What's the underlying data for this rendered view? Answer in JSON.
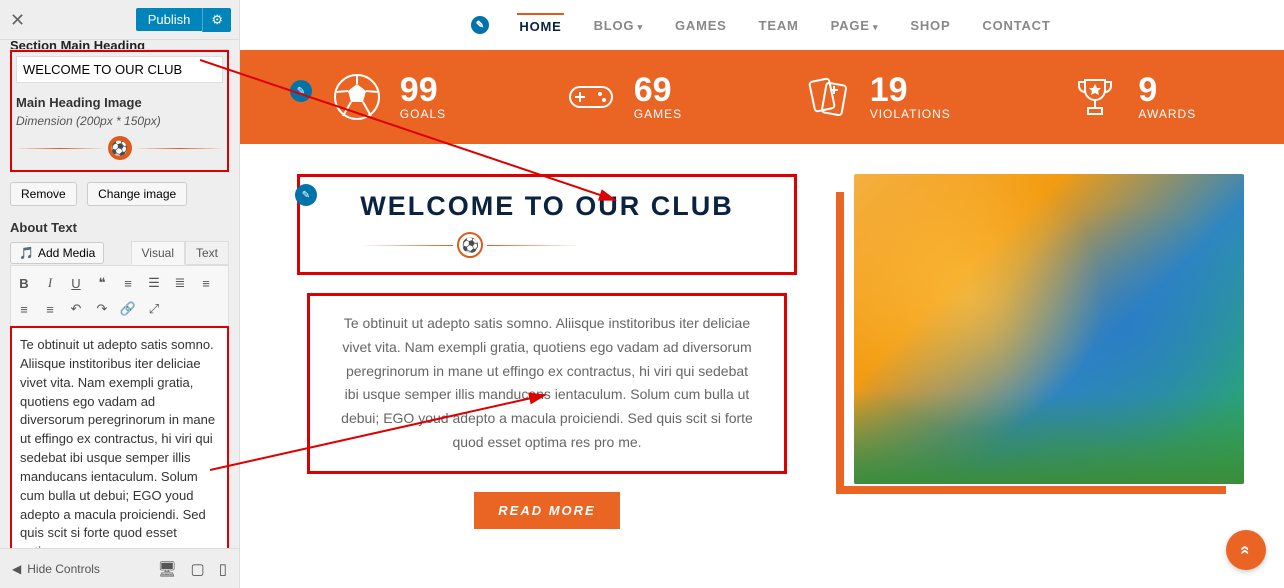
{
  "sidebar": {
    "section_title_truncated": "Section Main Heading",
    "publish": "Publish",
    "heading_field": {
      "value": "WELCOME TO OUR CLUB"
    },
    "main_heading_image": {
      "label": "Main Heading Image",
      "note": "Dimension (200px * 150px)"
    },
    "remove": "Remove",
    "change_image": "Change image",
    "about_label": "About Text",
    "add_media": "Add Media",
    "tabs": {
      "visual": "Visual",
      "text": "Text"
    },
    "about_body": "Te obtinuit ut adepto satis somno. Aliisque institoribus iter deliciae vivet vita. Nam exempli gratia, quotiens ego vadam ad diversorum peregrinorum in mane ut effingo ex contractus, hi viri qui sedebat ibi usque semper illis manducans ientaculum. Solum cum bulla ut debui; EGO youd adepto a macula proiciendi. Sed quis scit si forte quod esset optima res pro me.",
    "hide_controls": "Hide Controls"
  },
  "nav": {
    "items": [
      "Home",
      "Blog",
      "Games",
      "Team",
      "Page",
      "Shop",
      "Contact"
    ]
  },
  "stats": [
    {
      "num": "99",
      "lbl": "GOALS",
      "icon": "soccer"
    },
    {
      "num": "69",
      "lbl": "GAMES",
      "icon": "gamepad"
    },
    {
      "num": "19",
      "lbl": "VIOLATIONS",
      "icon": "cards"
    },
    {
      "num": "9",
      "lbl": "AWARDS",
      "icon": "trophy"
    }
  ],
  "hero": {
    "title": "WELCOME TO OUR CLUB",
    "about": "Te obtinuit ut adepto satis somno. Aliisque institoribus iter deliciae vivet vita. Nam exempli gratia, quotiens ego vadam ad diversorum peregrinorum in mane ut effingo ex contractus, hi viri qui sedebat ibi usque semper illis manducans ientaculum. Solum cum bulla ut debui; EGO youd adepto a macula proiciendi. Sed quis scit si forte quod esset optima res pro me.",
    "read_more": "READ MORE"
  }
}
